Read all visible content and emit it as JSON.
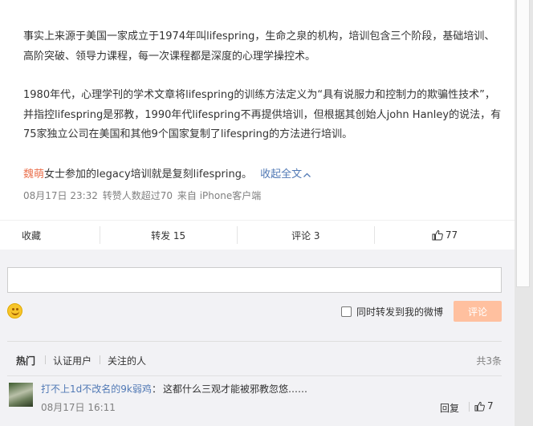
{
  "post": {
    "paragraph1": "事实上来源于美国一家成立于1974年叫lifespring，生命之泉的机构，培训包含三个阶段，基础培训、高阶突破、领导力课程，每一次课程都是深度的心理学操控术。",
    "paragraph2": "1980年代，心理学刊的学术文章将lifespring的训练方法定义为“具有说服力和控制力的欺骗性技术”，并指控lifespring是邪教，1990年代lifespring不再提供培训，但根据其创始人john Hanley的说法，有75家独立公司在美国和其他9个国家复制了lifespring的方法进行培训。",
    "mention": "魏萌",
    "paragraph3_tail": "女士参加的legacy培训就是复刻lifespring。",
    "collapse_label": "收起全文",
    "time": "08月17日 23:32",
    "repost_info": "转赞人数超过70",
    "source": "来自 iPhone客户端"
  },
  "actions": {
    "favorite": "收藏",
    "repost": "转发 15",
    "comment": "评论 3",
    "like": "77"
  },
  "composer": {
    "placeholder": "",
    "forward_label": "同时转发到我的微博",
    "submit_label": "评论"
  },
  "comment_tabs": {
    "hot": "热门",
    "verified": "认证用户",
    "following": "关注的人",
    "total": "共3条"
  },
  "comments": [
    {
      "user": "打不上1d不改名的9k弱鸡",
      "colon": "：",
      "text": "这都什么三观才能被邪教忽悠……",
      "time": "08月17日 16:11",
      "reply": "回复",
      "likes": "7"
    }
  ],
  "colors": {
    "link": "#5179b5",
    "mention": "#eb7350",
    "submit_bg": "#ffc09f"
  }
}
